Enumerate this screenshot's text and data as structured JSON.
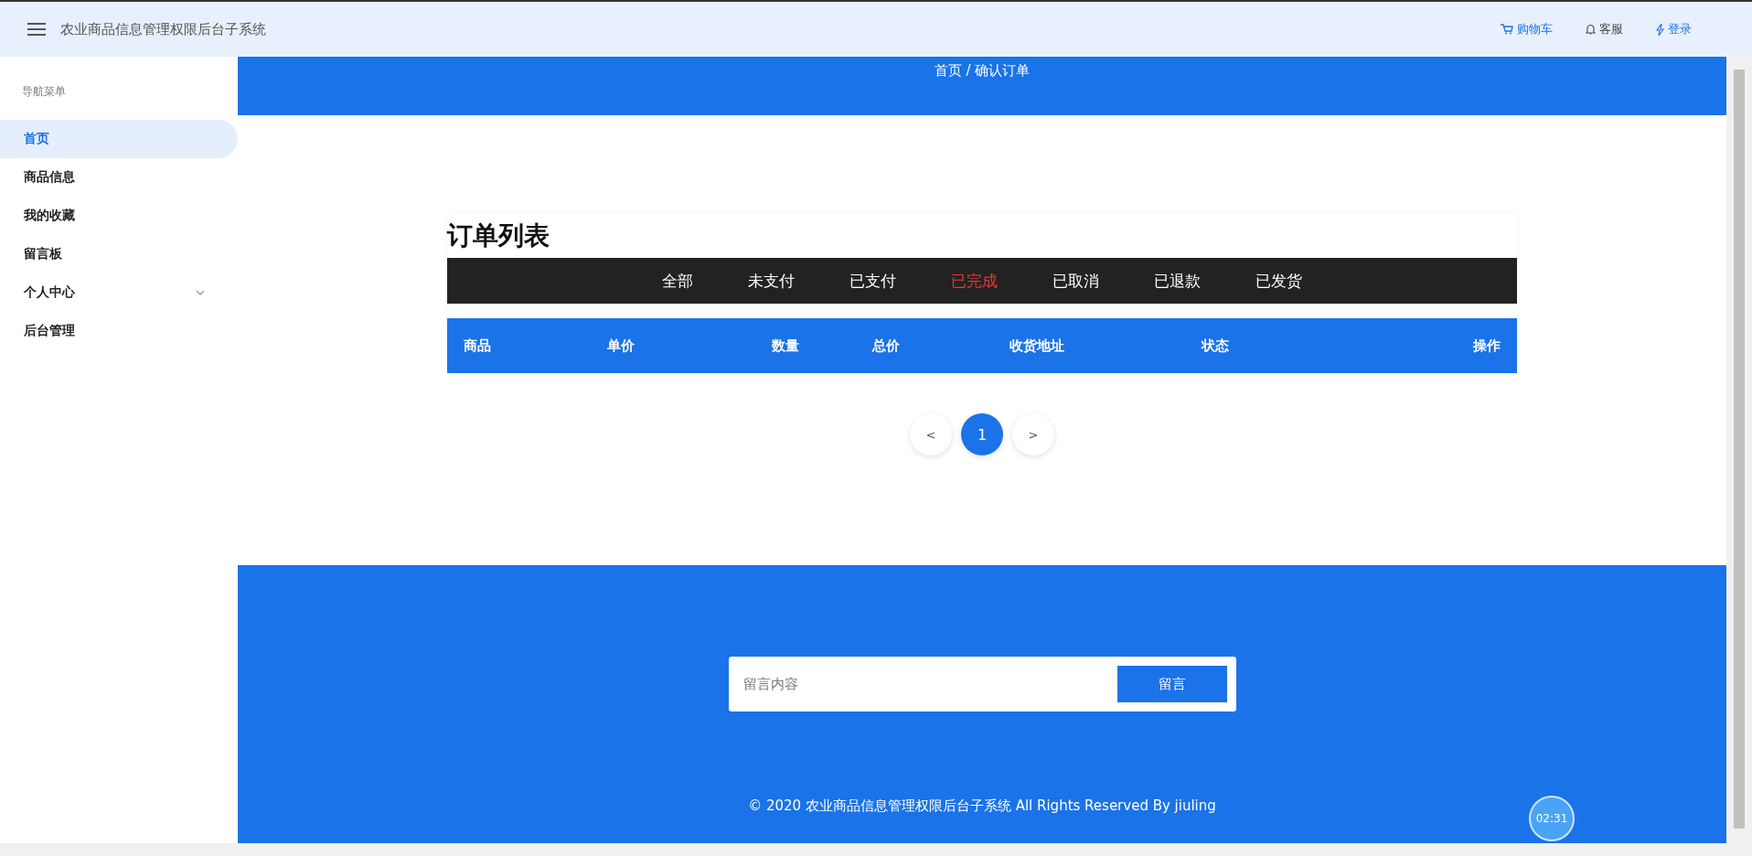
{
  "header": {
    "title": "农业商品信息管理权限后台子系统",
    "actions": [
      {
        "label": "购物车",
        "kind": "cart"
      },
      {
        "label": "客服",
        "kind": "bell"
      },
      {
        "label": "登录",
        "kind": "bolt"
      }
    ]
  },
  "sidebar": {
    "heading": "导航菜单",
    "items": [
      {
        "label": "首页",
        "selected": true
      },
      {
        "label": "商品信息",
        "selected": false
      },
      {
        "label": "我的收藏",
        "selected": false
      },
      {
        "label": "留言板",
        "selected": false
      },
      {
        "label": "个人中心",
        "selected": false,
        "expandable": true
      },
      {
        "label": "后台管理",
        "selected": false
      }
    ]
  },
  "breadcrumb": "首页 / 确认订单",
  "orders": {
    "title": "订单列表",
    "tabs": [
      {
        "label": "全部",
        "selected": false
      },
      {
        "label": "未支付",
        "selected": false
      },
      {
        "label": "已支付",
        "selected": false
      },
      {
        "label": "已完成",
        "selected": true
      },
      {
        "label": "已取消",
        "selected": false
      },
      {
        "label": "已退款",
        "selected": false
      },
      {
        "label": "已发货",
        "selected": false
      }
    ],
    "columns": [
      "商品",
      "单价",
      "数量",
      "总价",
      "收货地址",
      "状态",
      "操作"
    ],
    "pagination": {
      "prev": "<",
      "pages": [
        {
          "label": "1",
          "selected": true
        }
      ],
      "next": ">"
    }
  },
  "footer": {
    "message": {
      "placeholder": "留言内容",
      "button": "留言"
    },
    "copyright": "© 2020 农业商品信息管理权限后台子系统 All Rights Reserved By jiuling",
    "timer": "02:31"
  }
}
